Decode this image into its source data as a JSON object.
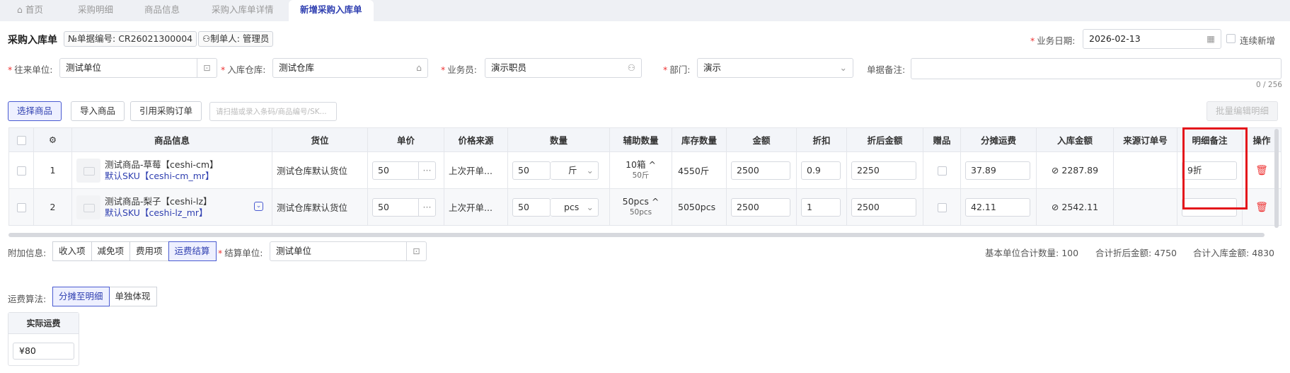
{
  "tabs": [
    {
      "label": "首页",
      "icon": "home-icon"
    },
    {
      "label": "采购明细"
    },
    {
      "label": "商品信息"
    },
    {
      "label": "采购入库单详情"
    },
    {
      "label": "新增采购入库单"
    }
  ],
  "header": {
    "title": "采购入库单",
    "doc_no_label": "№单据编号:",
    "doc_no": "CR26021300004",
    "maker_label": "制单人:",
    "maker": "管理员",
    "date_label": "业务日期:",
    "date": "2026-02-13",
    "continue_label": "连续新增"
  },
  "form": {
    "partner_label": "往来单位:",
    "partner": "测试单位",
    "warehouse_label": "入库仓库:",
    "warehouse": "测试仓库",
    "salesman_label": "业务员:",
    "salesman": "演示职员",
    "dept_label": "部门:",
    "dept": "演示",
    "remark_label": "单据备注:",
    "remark": "",
    "remark_count": "0 / 256"
  },
  "toolbar": {
    "select_goods": "选择商品",
    "import_goods": "导入商品",
    "quote_order": "引用采购订单",
    "scan_placeholder": "请扫描或录入条码/商品编号/SK...",
    "batch_edit": "批量编辑明细"
  },
  "table": {
    "columns": [
      "",
      "⚙",
      "商品信息",
      "货位",
      "单价",
      "价格来源",
      "数量",
      "辅助数量",
      "库存数量",
      "金额",
      "折扣",
      "折后金额",
      "赠品",
      "分摊运费",
      "入库金额",
      "来源订单号",
      "明细备注",
      "操作"
    ],
    "rows": [
      {
        "idx": "1",
        "name": "测试商品-草莓【ceshi-cm】",
        "sku": "默认SKU【ceshi-cm_mr】",
        "location": "测试仓库默认货位",
        "price": "50",
        "price_source": "上次开单...",
        "qty": "50",
        "unit": "斤",
        "aux_main": "10箱",
        "aux_sub": "50斤",
        "stock": "4550斤",
        "amount": "2500",
        "discount": "0.9",
        "disc_amount": "2250",
        "freight": "37.89",
        "in_amount": "2287.89",
        "source_no": "",
        "remark": "9折"
      },
      {
        "idx": "2",
        "name": "测试商品-梨子【ceshi-lz】",
        "sku": "默认SKU【ceshi-lz_mr】",
        "location": "测试仓库默认货位",
        "price": "50",
        "price_source": "上次开单...",
        "qty": "50",
        "unit": "pcs",
        "aux_main": "50pcs",
        "aux_sub": "50pcs",
        "stock": "5050pcs",
        "amount": "2500",
        "discount": "1",
        "disc_amount": "2500",
        "freight": "42.11",
        "in_amount": "2542.11",
        "source_no": "",
        "remark": ""
      }
    ]
  },
  "extra": {
    "label": "附加信息:",
    "tabs": [
      "收入项",
      "减免项",
      "费用项",
      "运费结算"
    ],
    "settle_label": "结算单位:",
    "settle_unit": "测试单位",
    "sum_qty_label": "基本单位合计数量:",
    "sum_qty": "100",
    "sum_disc_label": "合计折后金额:",
    "sum_disc": "4750",
    "sum_in_label": "合计入库金额:",
    "sum_in": "4830"
  },
  "freight": {
    "label": "运费算法:",
    "options": [
      "分摊至明细",
      "单独体现"
    ],
    "actual_label": "实际运费",
    "actual_value": "¥80"
  }
}
